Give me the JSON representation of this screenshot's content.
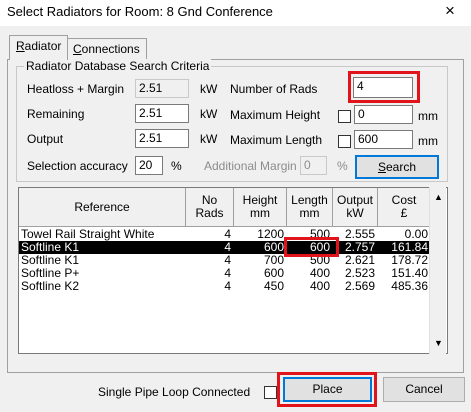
{
  "window": {
    "title": "Select Radiators for Room: 8  Gnd Conference",
    "close_icon": "×"
  },
  "tabs": [
    {
      "label": "Radiator",
      "mnemonic": "R",
      "rest": "adiator",
      "active": true
    },
    {
      "label": "Connections",
      "mnemonic": "C",
      "rest": "onnections",
      "active": false
    }
  ],
  "criteria": {
    "legend": "Radiator Database Search Criteria",
    "heatloss_label": "Heatloss + Margin",
    "heatloss_value": "2.51",
    "heatloss_unit": "kW",
    "remaining_label": "Remaining",
    "remaining_value": "2.51",
    "remaining_unit": "kW",
    "output_label": "Output",
    "output_value": "2.51",
    "output_unit": "kW",
    "accuracy_label": "Selection accuracy",
    "accuracy_value": "20",
    "accuracy_unit": "%",
    "num_rads_label": "Number of Rads",
    "num_rads_value": "4",
    "max_height_label": "Maximum Height",
    "max_height_value": "0",
    "max_height_unit": "mm",
    "max_length_label": "Maximum Length",
    "max_length_value": "600",
    "max_length_unit": "mm",
    "add_margin_label": "Additional Margin",
    "add_margin_value": "0",
    "add_margin_unit": "%",
    "search_label": "Search",
    "search_mnemonic": "S",
    "search_rest": "earch"
  },
  "table": {
    "columns": [
      {
        "line1": "Reference",
        "line2": ""
      },
      {
        "line1": "No",
        "line2": "Rads"
      },
      {
        "line1": "Height",
        "line2": "mm"
      },
      {
        "line1": "Length",
        "line2": "mm"
      },
      {
        "line1": "Output",
        "line2": "kW"
      },
      {
        "line1": "Cost",
        "line2": "£"
      }
    ],
    "rows": [
      {
        "ref": "Towel Rail Straight White",
        "rads": "4",
        "height": "1200",
        "length": "500",
        "output": "2.555",
        "cost": "0.00"
      },
      {
        "ref": "Softline K1",
        "rads": "4",
        "height": "600",
        "length": "600",
        "output": "2.757",
        "cost": "161.84"
      },
      {
        "ref": "Softline K1",
        "rads": "4",
        "height": "700",
        "length": "500",
        "output": "2.621",
        "cost": "178.72"
      },
      {
        "ref": "Softline P+",
        "rads": "4",
        "height": "600",
        "length": "400",
        "output": "2.523",
        "cost": "151.40"
      },
      {
        "ref": "Softline K2",
        "rads": "4",
        "height": "450",
        "length": "400",
        "output": "2.569",
        "cost": "485.36"
      }
    ],
    "selected_row": 1
  },
  "footer": {
    "single_pipe_label": "Single Pipe Loop Connected",
    "place_label": "Place",
    "cancel_label": "Cancel"
  },
  "colors": {
    "highlight": "#e1141b",
    "selection": "#000000"
  }
}
